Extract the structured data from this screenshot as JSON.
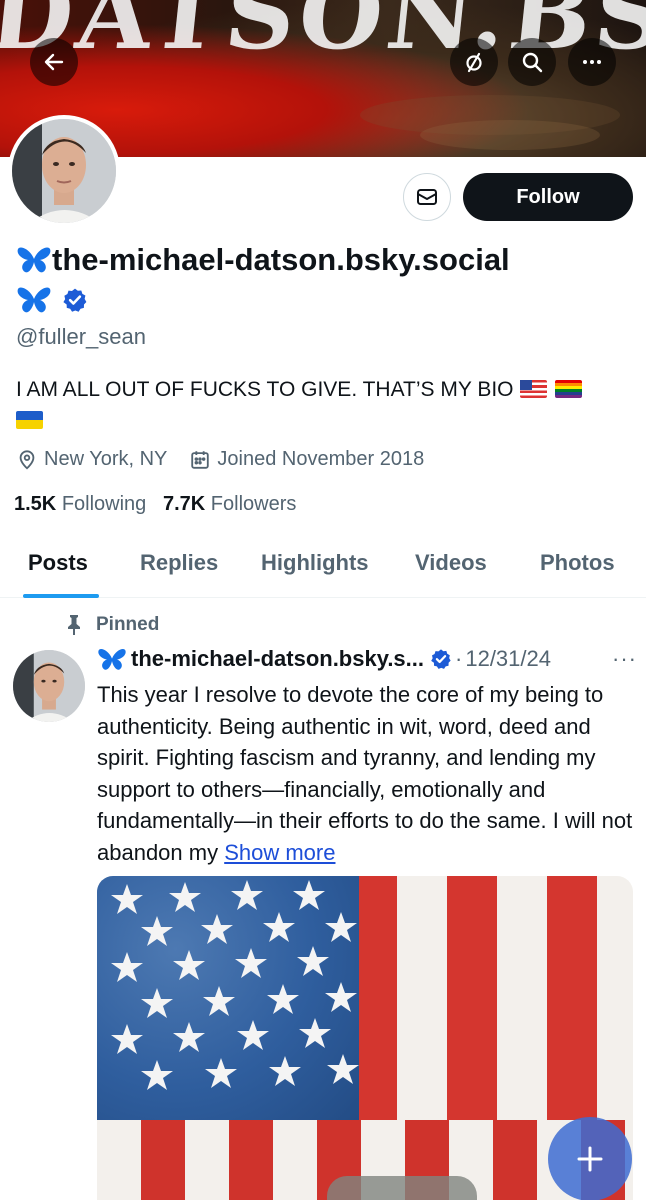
{
  "banner": {
    "watermark_text": "DATSON.BSKY"
  },
  "header": {
    "back_icon": "arrow-left-icon",
    "muted_icon": "circle-slash-icon",
    "search_icon": "search-icon",
    "more_icon": "more-horizontal-icon"
  },
  "profile": {
    "display_name": "the-michael-datson.bsky.social",
    "handle": "@fuller_sean",
    "bio": "I AM ALL OUT OF FUCKS TO GIVE. THAT’S MY BIO",
    "location": "New York, NY",
    "joined": "Joined November 2018",
    "following_count": "1.5K",
    "following_label": "Following",
    "followers_count": "7.7K",
    "followers_label": "Followers",
    "follow_label": "Follow"
  },
  "tabs": [
    {
      "label": "Posts"
    },
    {
      "label": "Replies"
    },
    {
      "label": "Highlights"
    },
    {
      "label": "Videos"
    },
    {
      "label": "Photos"
    }
  ],
  "post": {
    "pinned_label": "Pinned",
    "author_name": "the-michael-datson.bsky.s...",
    "separator": "·",
    "date": "12/31/24",
    "more": "···",
    "text": "This year I resolve to devote the core of my being to authenticity. Being authentic in wit, word, deed and spirit. Fighting fascism and tyranny, and lending my support to others—financially, emotionally and fundamentally—in their efforts to do the same. I will not abandon my ",
    "show_more": "Show more"
  },
  "colors": {
    "accent": "#1d9bf0",
    "verified": "#1d9bf0",
    "follow_bg": "#0f1419"
  }
}
